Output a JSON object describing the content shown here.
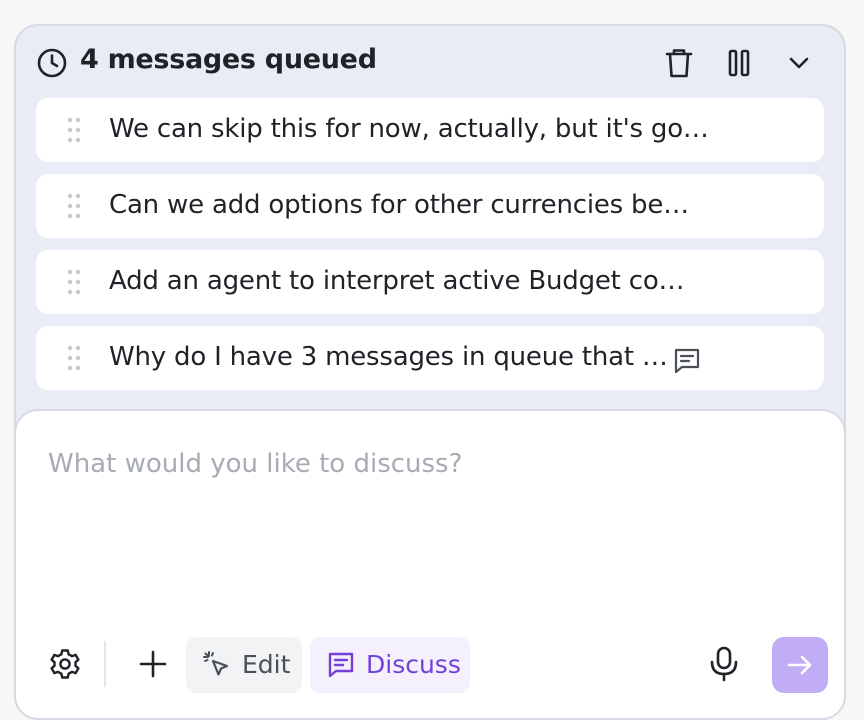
{
  "queue": {
    "title": "4 messages queued",
    "items": [
      {
        "text": "We can skip this for now, actually, but it's go…"
      },
      {
        "text": "Can we add options for other currencies be…"
      },
      {
        "text": "Add an agent to interpret active Budget co…"
      },
      {
        "text": "Why do I have 3 messages in queue that …"
      }
    ]
  },
  "composer": {
    "placeholder": "What would you like to discuss?"
  },
  "toolbar": {
    "edit_label": "Edit",
    "discuss_label": "Discuss"
  },
  "colors": {
    "accent": "#7340d8",
    "send_button": "#c0adf5",
    "queue_background": "#e9ecf4"
  },
  "icons": [
    "clock-icon",
    "trash-icon",
    "pause-icon",
    "chevron-down-icon",
    "drag-handle-icon",
    "comment-icon",
    "gear-icon",
    "plus-icon",
    "cursor-click-icon",
    "discuss-icon",
    "microphone-icon",
    "arrow-right-icon"
  ]
}
